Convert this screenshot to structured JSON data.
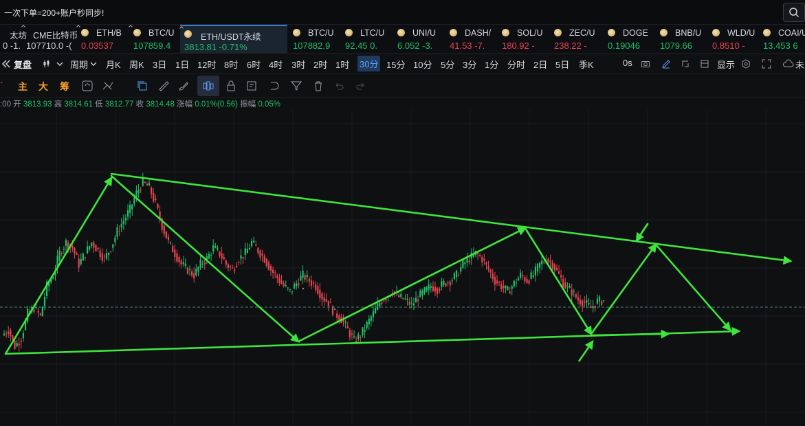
{
  "banner": {
    "text": "一次下单=200+账户秒同步!"
  },
  "tickers": [
    {
      "name": "太坊",
      "price": "0 -1.",
      "price_color": "white",
      "coin": false,
      "pin": false
    },
    {
      "name": "CME比特币",
      "price": "107710.0 -(",
      "price_color": "white",
      "coin": false,
      "pin": true
    },
    {
      "name": "ETH/B",
      "price": "0.03537",
      "price_color": "red",
      "coin": true,
      "pin": true
    },
    {
      "name": "BTC/U",
      "price": "107859.4",
      "price_color": "green",
      "coin": true,
      "pin": true
    },
    {
      "name": "ETH/USDT永续",
      "price": "3813.81  -0.71%",
      "price_color": "green",
      "coin": true,
      "pin": true,
      "active": true
    },
    {
      "name": "BTC/U",
      "price": "107882.9",
      "price_color": "green",
      "coin": true,
      "pin": false
    },
    {
      "name": "LTC/U",
      "price": "92.45  0.",
      "price_color": "green",
      "coin": true,
      "pin": false
    },
    {
      "name": "UNI/U",
      "price": "6.052  -3.",
      "price_color": "green",
      "coin": true,
      "pin": false
    },
    {
      "name": "DASH/",
      "price": "41.53  -7.",
      "price_color": "red",
      "coin": true,
      "pin": false
    },
    {
      "name": "SOL/U",
      "price": "180.92  -",
      "price_color": "red",
      "coin": true,
      "pin": false
    },
    {
      "name": "ZEC/U",
      "price": "238.22  -",
      "price_color": "red",
      "coin": true,
      "pin": false
    },
    {
      "name": "DOGE",
      "price": "0.19046",
      "price_color": "green",
      "coin": true,
      "pin": false
    },
    {
      "name": "BNB/U",
      "price": "1079.66",
      "price_color": "green",
      "coin": true,
      "pin": false
    },
    {
      "name": "WLD/U",
      "price": "0.8510  -",
      "price_color": "red",
      "coin": true,
      "pin": false
    },
    {
      "name": "COAI/U",
      "price": "13.453  6",
      "price_color": "green",
      "coin": true,
      "pin": false
    }
  ],
  "periodbar": {
    "replay": "复盘",
    "cycle": "周期",
    "periods": [
      "月K",
      "周K",
      "3日",
      "1日",
      "12时",
      "8时",
      "6时",
      "4时",
      "3时",
      "2时",
      "1时",
      "30分",
      "15分",
      "10分",
      "5分",
      "3分",
      "1分",
      "分时",
      "2日",
      "5日",
      "季K"
    ],
    "active_period": "30分",
    "countdown": "0s",
    "display": "显示",
    "cloud": "未"
  },
  "toolbar": {
    "chars": [
      "主",
      "大",
      "筹"
    ]
  },
  "ohlc": {
    "time": ":00",
    "open_label": "开",
    "open": "3813.93",
    "high_label": "高",
    "high": "3814.61",
    "low_label": "低",
    "low": "3812.77",
    "close_label": "收",
    "close": "3814.48",
    "change_label": "涨幅",
    "change": "0.01%(0.56)",
    "amp_label": "振幅",
    "amp": "0.05%"
  },
  "chart_data": {
    "type": "candlestick",
    "interval": "30分",
    "note_price_now": 3813.81,
    "closes": [
      3760,
      3730,
      3745,
      3790,
      3800,
      3785,
      3840,
      3860,
      3900,
      3920,
      3910,
      3880,
      3900,
      3920,
      3905,
      3890,
      3910,
      3940,
      3960,
      3980,
      4010,
      4030,
      4020,
      3990,
      3950,
      3920,
      3900,
      3880,
      3870,
      3860,
      3880,
      3890,
      3910,
      3900,
      3880,
      3870,
      3890,
      3900,
      3920,
      3905,
      3890,
      3870,
      3855,
      3840,
      3830,
      3845,
      3860,
      3850,
      3840,
      3820,
      3810,
      3790,
      3780,
      3760,
      3740,
      3750,
      3770,
      3790,
      3810,
      3820,
      3830,
      3820,
      3815,
      3805,
      3820,
      3830,
      3840,
      3835,
      3845,
      3850,
      3860,
      3880,
      3890,
      3900,
      3890,
      3870,
      3850,
      3840,
      3830,
      3845,
      3860,
      3850,
      3860,
      3880,
      3890,
      3880,
      3860,
      3840,
      3830,
      3815,
      3810,
      3800,
      3812,
      3814
    ],
    "series_color_up": "#21c06a",
    "series_color_down": "#e8454f",
    "annotation_color": "#3ee53e"
  }
}
